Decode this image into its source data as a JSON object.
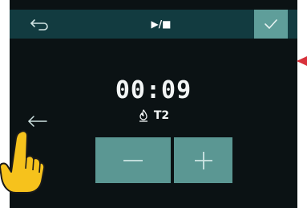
{
  "topbar": {
    "back_icon": "back-arrow-icon",
    "play_stop_label": "▶/■",
    "confirm_icon": "checkmark-icon"
  },
  "timer": {
    "value": "00:09"
  },
  "program": {
    "icon": "flame-icon",
    "label": "T2"
  },
  "controls": {
    "minus_icon": "minus-icon",
    "plus_icon": "plus-icon"
  },
  "navigation": {
    "left_arrow_icon": "left-arrow-icon"
  },
  "annotations": {
    "marker_color": "#d8323c",
    "pointer_icon": "pointing-hand-icon"
  },
  "colors": {
    "screen_bg": "#0b1214",
    "topbar_bg": "#123b40",
    "button_bg": "#5b9793",
    "confirm_bg": "#5f9e9a"
  }
}
